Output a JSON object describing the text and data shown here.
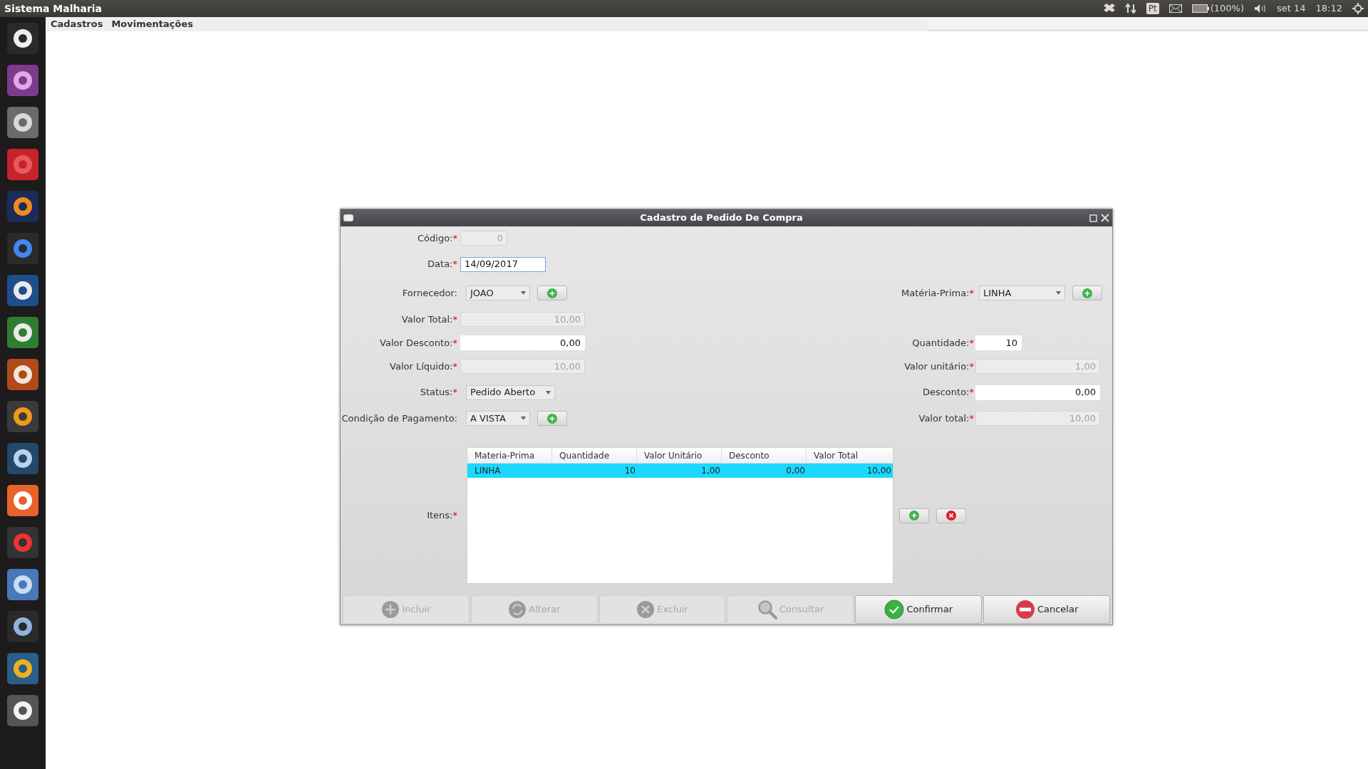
{
  "top_bar": {
    "title": "Sistema Malharia",
    "keyboard": "Pt",
    "battery": "(100%)",
    "date": "set 14",
    "time": "18:12"
  },
  "menu": [
    "Cadastros",
    "Movimentações"
  ],
  "dialog": {
    "title": "Cadastro de Pedido De Compra",
    "rows": [
      {
        "left": {
          "label": "Código:",
          "required": "*",
          "kind": "field",
          "value": "0",
          "disabled": true,
          "focused": false
        }
      },
      {
        "left": {
          "label": "Data:",
          "required": "*",
          "kind": "field",
          "value": "14/09/2017",
          "disabled": false,
          "focused": true
        }
      },
      {
        "left": {
          "label": "Fornecedor:",
          "kind": "combo_add",
          "value": "JOAO"
        },
        "right": {
          "label": "Matéria-Prima:",
          "required": "*",
          "kind": "combo_add",
          "value": "LINHA"
        }
      },
      {
        "left": {
          "label": "Valor Total:",
          "required": "*",
          "kind": "field",
          "value": "10,00",
          "disabled": true,
          "focused": false
        }
      },
      {
        "left": {
          "label": "Valor Desconto:",
          "required": "*",
          "kind": "field",
          "value": "0,00",
          "disabled": false,
          "focused": false
        },
        "right": {
          "label": "Quantidade:",
          "required": "*",
          "kind": "field",
          "value": "10",
          "disabled": false,
          "focused": false
        }
      },
      {
        "left": {
          "label": "Valor Líquido:",
          "required": "*",
          "kind": "field",
          "value": "10,00",
          "disabled": true,
          "focused": false
        },
        "right": {
          "label": "Valor unitário:",
          "required": "*",
          "kind": "field",
          "value": "1,00",
          "disabled": true,
          "focused": false
        }
      },
      {
        "left": {
          "label": "Status:",
          "required": "*",
          "kind": "combo",
          "value": "Pedido Aberto"
        },
        "right": {
          "label": "Desconto:",
          "required": "*",
          "kind": "field",
          "value": "0,00",
          "disabled": false,
          "focused": false
        }
      },
      {
        "left": {
          "label": "Condição de Pagamento:",
          "kind": "combo_add",
          "value": "A VISTA"
        },
        "right": {
          "label": "Valor total:",
          "required": "*",
          "kind": "field",
          "value": "10,00",
          "disabled": true,
          "focused": false
        }
      }
    ],
    "items": {
      "label": "Itens:",
      "required": "*",
      "columns": [
        "Materia-Prima",
        "Quantidade",
        "Valor Unitário",
        "Desconto",
        "Valor Total"
      ],
      "rows": [
        {
          "cells": [
            "LINHA",
            "10",
            "1,00",
            "0,00",
            "10,00"
          ],
          "selected": true
        }
      ]
    },
    "buttons": [
      {
        "label": "Incluir",
        "kind": "plus",
        "disabled": true
      },
      {
        "label": "Alterar",
        "kind": "refresh",
        "disabled": true
      },
      {
        "label": "Excluir",
        "kind": "cross",
        "disabled": true
      },
      {
        "label": "Consultar",
        "kind": "search",
        "disabled": true
      },
      {
        "label": "Confirmar",
        "kind": "check",
        "disabled": false
      },
      {
        "label": "Cancelar",
        "kind": "minus",
        "disabled": false
      }
    ]
  }
}
